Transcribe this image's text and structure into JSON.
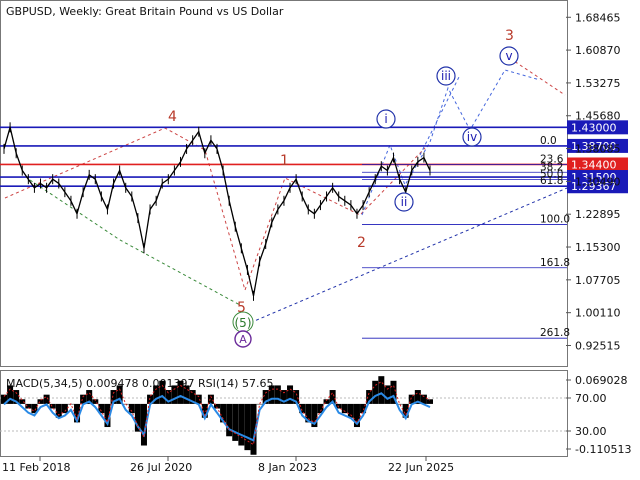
{
  "chart_data": {
    "type": "line",
    "title": "GBPUSD, Weekly:  Great Britain Pound vs US Dollar",
    "y_ticks": [
      "1.68465",
      "1.60870",
      "1.53275",
      "1.45680",
      "1.38085",
      "1.30490",
      "1.22895",
      "1.15300",
      "1.07705",
      "1.00110",
      "0.92515"
    ],
    "ylim": [
      0.88,
      1.72
    ],
    "x_ticks": [
      "11 Feb 2018",
      "26 Jul 2020",
      "8 Jan 2023",
      "22 Jun 2025"
    ],
    "price_series": {
      "name": "",
      "values": [
        1.38,
        1.43,
        1.37,
        1.33,
        1.31,
        1.29,
        1.3,
        1.29,
        1.31,
        1.3,
        1.28,
        1.26,
        1.23,
        1.28,
        1.32,
        1.31,
        1.27,
        1.24,
        1.3,
        1.33,
        1.29,
        1.27,
        1.22,
        1.15,
        1.24,
        1.26,
        1.3,
        1.31,
        1.33,
        1.35,
        1.38,
        1.4,
        1.42,
        1.37,
        1.4,
        1.38,
        1.33,
        1.26,
        1.2,
        1.15,
        1.1,
        1.04,
        1.12,
        1.16,
        1.21,
        1.24,
        1.26,
        1.29,
        1.31,
        1.27,
        1.24,
        1.23,
        1.25,
        1.27,
        1.29,
        1.27,
        1.26,
        1.25,
        1.23,
        1.25,
        1.28,
        1.31,
        1.34,
        1.33,
        1.36,
        1.31,
        1.28,
        1.33,
        1.35,
        1.36,
        1.33
      ],
      "highlighted_levels": [
        {
          "label": "1.43000",
          "value": 1.43
        },
        {
          "label": "1.38700",
          "value": 1.387
        },
        {
          "label": "1.34400",
          "value": 1.344
        },
        {
          "label": "1.31500",
          "value": 1.315
        },
        {
          "label": "1.29367",
          "value": 1.29367
        }
      ],
      "fibonacci_levels": [
        {
          "label": "0.0",
          "value": 1.387
        },
        {
          "label": "23.6",
          "value": 1.344
        },
        {
          "label": "38.2",
          "value": 1.326
        },
        {
          "label": "50.0",
          "value": 1.309
        },
        {
          "label": "61.8",
          "value": 1.2937
        },
        {
          "label": "100.0",
          "value": 1.205
        },
        {
          "label": "161.8",
          "value": 1.105
        },
        {
          "label": "261.8",
          "value": 0.942
        }
      ],
      "wave_labels_red": [
        "4",
        "1",
        "2",
        "3",
        "5"
      ],
      "wave_labels_blue": [
        "i",
        "ii",
        "iii",
        "iv",
        "v"
      ],
      "wave_labels_green": [
        "(5)"
      ],
      "wave_labels_badge": [
        "A"
      ]
    },
    "indicator": {
      "title": "MACD(5,34,5) 0.009478 0.001397 RSI(14) 57.65",
      "y_ticks": [
        "0.069028",
        "70.00",
        "30.00",
        "-0.110513"
      ],
      "values": [
        0.02,
        0.04,
        0.03,
        0.01,
        -0.01,
        -0.02,
        0.01,
        0.02,
        -0.01,
        -0.03,
        -0.02,
        0.0,
        -0.04,
        0.02,
        0.03,
        0.01,
        -0.02,
        -0.05,
        0.03,
        0.04,
        0.0,
        -0.02,
        -0.06,
        -0.09,
        0.02,
        0.04,
        0.05,
        0.03,
        0.04,
        0.05,
        0.04,
        0.03,
        0.02,
        -0.03,
        0.02,
        -0.01,
        -0.04,
        -0.07,
        -0.08,
        -0.09,
        -0.1,
        -0.11,
        0.0,
        0.03,
        0.04,
        0.04,
        0.03,
        0.04,
        0.03,
        -0.02,
        -0.04,
        -0.05,
        -0.02,
        0.01,
        0.03,
        -0.01,
        -0.02,
        -0.03,
        -0.05,
        -0.02,
        0.03,
        0.05,
        0.06,
        0.04,
        0.05,
        0.0,
        -0.03,
        0.02,
        0.03,
        0.02,
        0.01
      ]
    }
  }
}
